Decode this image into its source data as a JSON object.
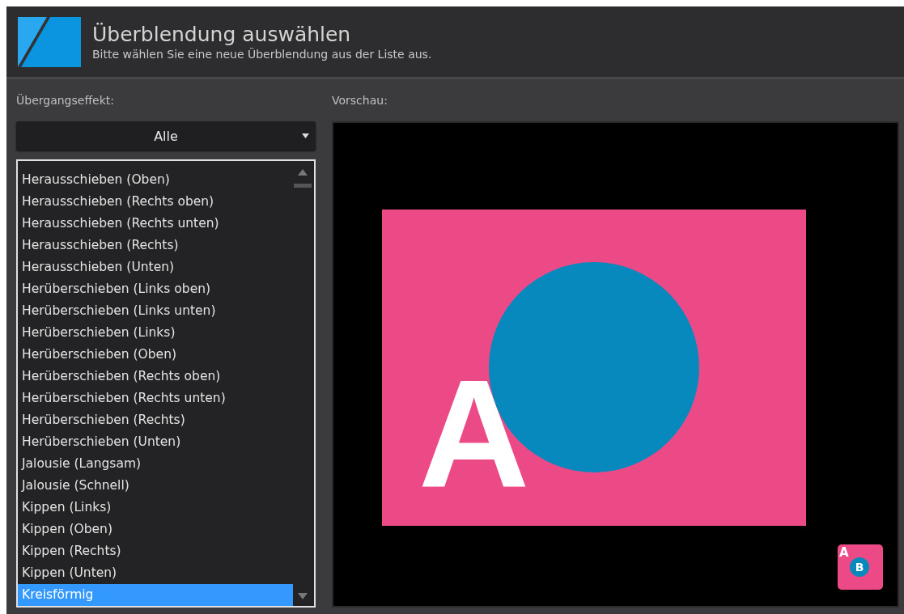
{
  "header": {
    "title": "Überblendung auswählen",
    "subtitle": "Bitte wählen Sie eine neue Überblendung aus der Liste aus."
  },
  "effects": {
    "label": "Übergangseffekt:",
    "filter": "Alle",
    "items": [
      {
        "label": "Herausschieben (Oben)",
        "selected": false
      },
      {
        "label": "Herausschieben (Rechts oben)",
        "selected": false
      },
      {
        "label": "Herausschieben (Rechts unten)",
        "selected": false
      },
      {
        "label": "Herausschieben (Rechts)",
        "selected": false
      },
      {
        "label": "Herausschieben (Unten)",
        "selected": false
      },
      {
        "label": "Herüberschieben (Links oben)",
        "selected": false
      },
      {
        "label": "Herüberschieben (Links unten)",
        "selected": false
      },
      {
        "label": "Herüberschieben (Links)",
        "selected": false
      },
      {
        "label": "Herüberschieben (Oben)",
        "selected": false
      },
      {
        "label": "Herüberschieben (Rechts oben)",
        "selected": false
      },
      {
        "label": "Herüberschieben (Rechts unten)",
        "selected": false
      },
      {
        "label": "Herüberschieben (Rechts)",
        "selected": false
      },
      {
        "label": "Herüberschieben (Unten)",
        "selected": false
      },
      {
        "label": "Jalousie (Langsam)",
        "selected": false
      },
      {
        "label": "Jalousie (Schnell)",
        "selected": false
      },
      {
        "label": "Kippen (Links)",
        "selected": false
      },
      {
        "label": "Kippen (Oben)",
        "selected": false
      },
      {
        "label": "Kippen (Rechts)",
        "selected": false
      },
      {
        "label": "Kippen (Unten)",
        "selected": false
      },
      {
        "label": "Kreisförmig",
        "selected": true
      }
    ]
  },
  "preview": {
    "label": "Vorschau:",
    "letter": "A",
    "badge": {
      "letter_a": "A",
      "letter_b": "B"
    }
  }
}
